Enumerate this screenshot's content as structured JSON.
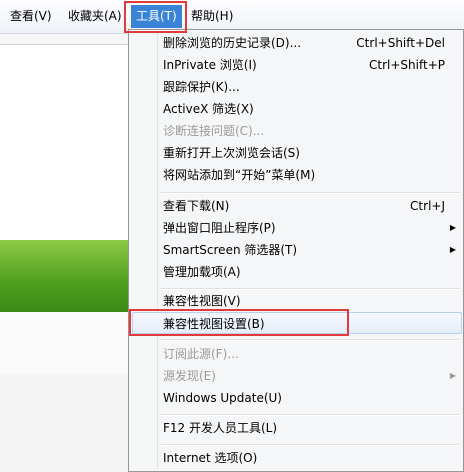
{
  "menubar": {
    "items": [
      {
        "label": "查看(V)"
      },
      {
        "label": "收藏夹(A)"
      },
      {
        "label": "工具(T)"
      },
      {
        "label": "帮助(H)"
      }
    ]
  },
  "tools_menu": {
    "items": [
      {
        "label": "删除浏览的历史记录(D)...",
        "shortcut": "Ctrl+Shift+Del"
      },
      {
        "label": "InPrivate 浏览(I)",
        "shortcut": "Ctrl+Shift+P"
      },
      {
        "label": "跟踪保护(K)..."
      },
      {
        "label": "ActiveX 筛选(X)"
      },
      {
        "label": "诊断连接问题(C)...",
        "disabled": true
      },
      {
        "label": "重新打开上次浏览会话(S)"
      },
      {
        "label": "将网站添加到“开始”菜单(M)"
      },
      {
        "label": "查看下载(N)",
        "shortcut": "Ctrl+J"
      },
      {
        "label": "弹出窗口阻止程序(P)",
        "submenu": true
      },
      {
        "label": "SmartScreen 筛选器(T)",
        "submenu": true
      },
      {
        "label": "管理加载项(A)"
      },
      {
        "label": "兼容性视图(V)"
      },
      {
        "label": "兼容性视图设置(B)",
        "highlighted": true
      },
      {
        "label": "订阅此源(F)...",
        "disabled": true
      },
      {
        "label": "源发现(E)",
        "disabled": true,
        "submenu": true
      },
      {
        "label": "Windows Update(U)"
      },
      {
        "label": "F12 开发人员工具(L)"
      },
      {
        "label": "Internet 选项(O)"
      }
    ]
  },
  "colors": {
    "menu_active": "#3a84d8",
    "highlight_box": "#e2393b",
    "disabled_text": "#9a9a9a"
  }
}
